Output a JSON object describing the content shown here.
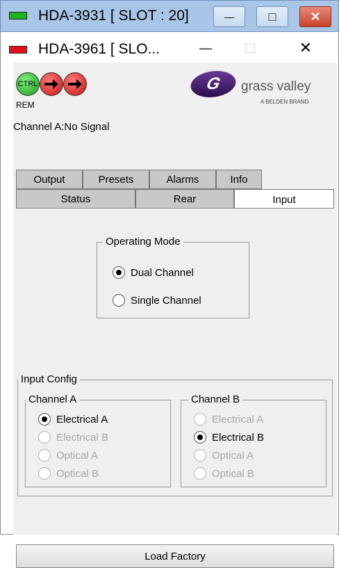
{
  "back_window": {
    "title": "HDA-3931 [ SLOT : 20]",
    "led_color": "#1fb31f",
    "minimize_icon": "—",
    "maximize_icon": "□",
    "close_icon": "✕"
  },
  "front_window": {
    "title": "HDA-3961 [ SLO...",
    "led_color": "#e0101c",
    "minimize_icon": "—",
    "maximize_icon": "□",
    "close_icon": "✕"
  },
  "header": {
    "ctrl_label": "CTRL",
    "rem_label": "REM",
    "logo_text": "grass valley",
    "logo_sub": "A BELDEN BRAND"
  },
  "status_line": "Channel A:No Signal",
  "tabs_row1": [
    {
      "label": "Output"
    },
    {
      "label": "Presets"
    },
    {
      "label": "Alarms"
    },
    {
      "label": "Info"
    }
  ],
  "tabs_row2": [
    {
      "label": "Status"
    },
    {
      "label": "Rear"
    },
    {
      "label": "Input",
      "active": true
    }
  ],
  "operating_mode": {
    "legend": "Operating Mode",
    "options": [
      {
        "label": "Dual Channel",
        "checked": true
      },
      {
        "label": "Single Channel",
        "checked": false
      }
    ]
  },
  "input_config": {
    "legend": "Input Config",
    "channel_a": {
      "legend": "Channel A",
      "options": [
        {
          "label": "Electrical A",
          "checked": true,
          "enabled": true
        },
        {
          "label": "Electrical B",
          "checked": false,
          "enabled": false
        },
        {
          "label": "Optical A",
          "checked": false,
          "enabled": false
        },
        {
          "label": "Optical B",
          "checked": false,
          "enabled": false
        }
      ]
    },
    "channel_b": {
      "legend": "Channel B",
      "options": [
        {
          "label": "Electrical A",
          "checked": false,
          "enabled": false
        },
        {
          "label": "Electrical B",
          "checked": true,
          "enabled": true
        },
        {
          "label": "Optical A",
          "checked": false,
          "enabled": false
        },
        {
          "label": "Optical B",
          "checked": false,
          "enabled": false
        }
      ]
    }
  },
  "load_factory_label": "Load Factory"
}
